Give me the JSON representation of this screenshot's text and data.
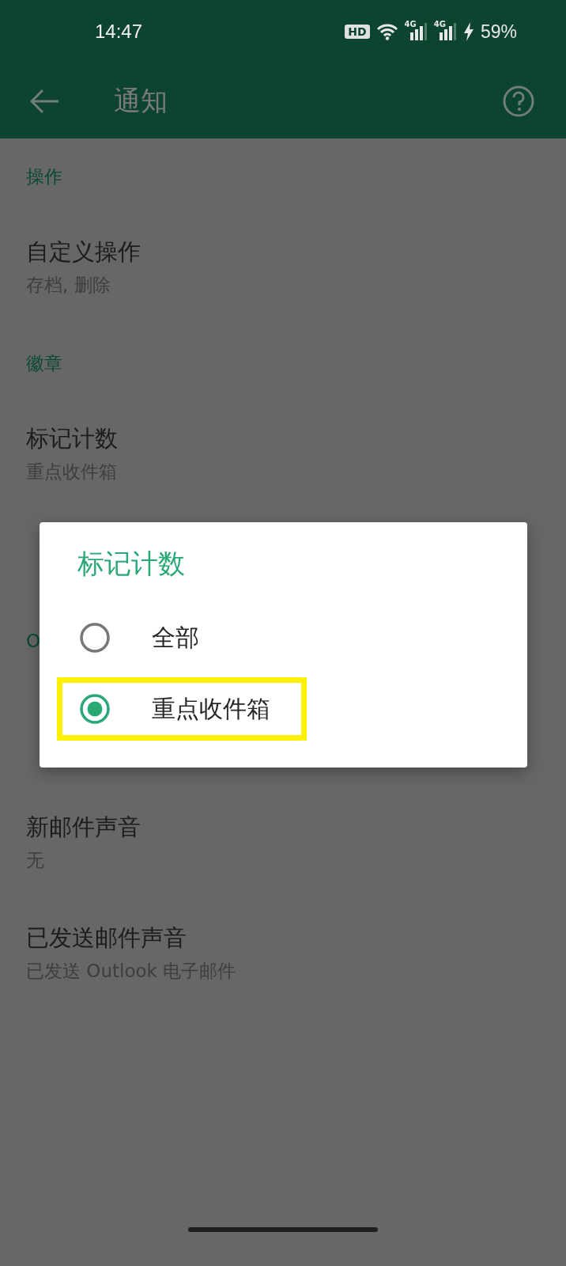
{
  "status_bar": {
    "time": "14:47",
    "hd_badge": "HD",
    "network_labels": [
      "4G",
      "4G"
    ],
    "battery": "59%"
  },
  "app_bar": {
    "title": "通知"
  },
  "sections": [
    {
      "header": "操作",
      "items": [
        {
          "title": "自定义操作",
          "subtitle": "存档, 删除"
        }
      ]
    },
    {
      "header": "徽章",
      "items": [
        {
          "title": "标记计数",
          "subtitle": "重点收件箱"
        }
      ]
    },
    {
      "header": "O",
      "items": [
        {
          "title": "新邮件声音",
          "subtitle": "无"
        },
        {
          "title": "已发送邮件声音",
          "subtitle": "已发送 Outlook 电子邮件"
        }
      ]
    }
  ],
  "dialog": {
    "title": "标记计数",
    "options": [
      {
        "label": "全部",
        "selected": false,
        "highlighted": false
      },
      {
        "label": "重点收件箱",
        "selected": true,
        "highlighted": true
      }
    ]
  }
}
